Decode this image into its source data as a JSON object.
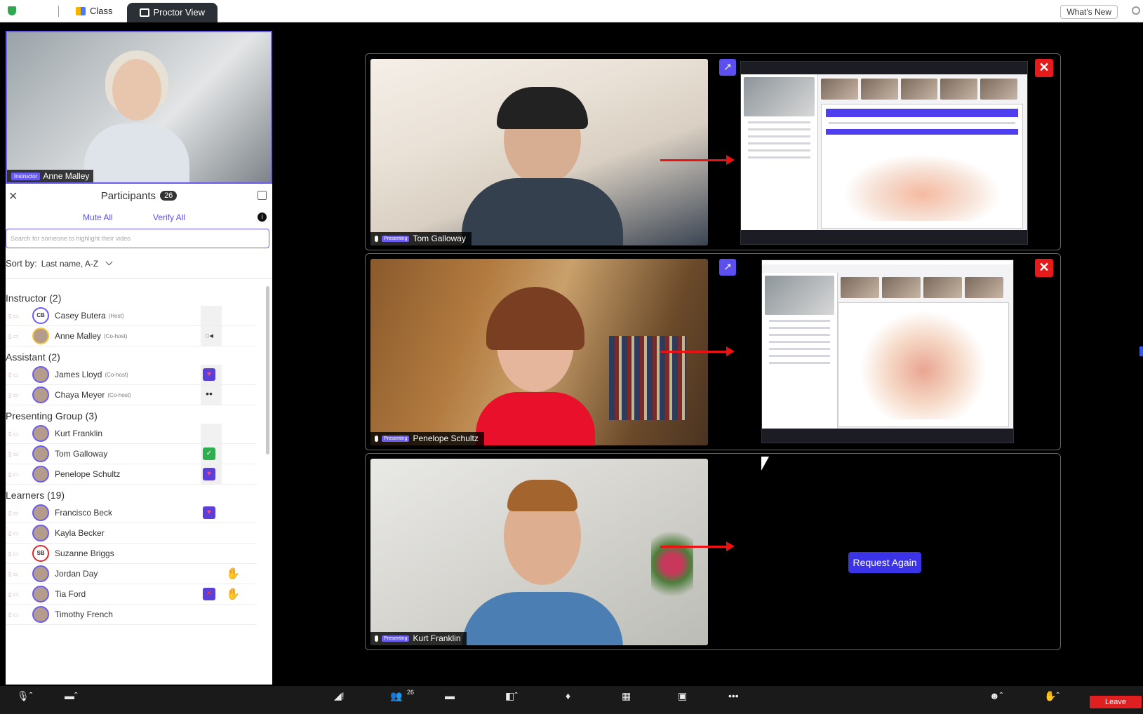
{
  "tabs": {
    "class_label": "Class",
    "proctor_label": "Proctor View"
  },
  "whats_new": "What's New",
  "instructor_video": {
    "badge": "Instructor",
    "name": "Anne Malley"
  },
  "participants": {
    "title": "Participants",
    "count": "26",
    "mute_all": "Mute All",
    "verify_all": "Verify All",
    "search_placeholder": "Search for someone to highlight their video",
    "sort_label": "Sort by:",
    "sort_value": "Last name, A-Z"
  },
  "groups": [
    {
      "title": "Instructor (2)",
      "members": [
        {
          "name": "Casey Butera",
          "role": "(Host)",
          "avatar": "CB"
        },
        {
          "name": "Anne Malley",
          "role": "(Co-host)",
          "status": "voice"
        }
      ]
    },
    {
      "title": "Assistant (2)",
      "members": [
        {
          "name": "James Lloyd",
          "role": "(Co-host)",
          "status": "heart"
        },
        {
          "name": "Chaya Meyer",
          "role": "(Co-host)",
          "status": "dots"
        }
      ]
    },
    {
      "title": "Presenting Group (3)",
      "members": [
        {
          "name": "Kurt Franklin"
        },
        {
          "name": "Tom Galloway",
          "status": "check"
        },
        {
          "name": "Penelope Schultz",
          "status": "heart"
        }
      ]
    },
    {
      "title": "Learners (19)",
      "members": [
        {
          "name": "Francisco Beck",
          "status": "heart"
        },
        {
          "name": "Kayla Becker"
        },
        {
          "name": "Suzanne Briggs",
          "avatar": "SB"
        },
        {
          "name": "Jordan Day",
          "hand": true
        },
        {
          "name": "Tia Ford",
          "status": "x",
          "hand": true
        },
        {
          "name": "Timothy French"
        }
      ]
    }
  ],
  "proctor_tiles": [
    {
      "presenting_badge": "Presenting",
      "name": "Tom Galloway"
    },
    {
      "presenting_badge": "Presenting",
      "name": "Penelope Schultz"
    },
    {
      "presenting_badge": "Presenting",
      "name": "Kurt Franklin",
      "request_again": "Request Again"
    }
  ],
  "toolbar": {
    "participants_count": "26",
    "leave": "Leave"
  },
  "colors": {
    "accent": "#5b4ff0",
    "danger": "#e51b1b",
    "bg": "#000000"
  },
  "icons": [
    "shield-icon",
    "class-icon",
    "proctor-view-icon",
    "close-icon",
    "popout-icon",
    "info-icon",
    "chevron-down-icon",
    "mic-icon",
    "video-icon",
    "participants-icon",
    "chat-icon",
    "share-screen-icon",
    "more-icon",
    "reactions-icon",
    "raise-hand-icon",
    "expand-icon"
  ]
}
